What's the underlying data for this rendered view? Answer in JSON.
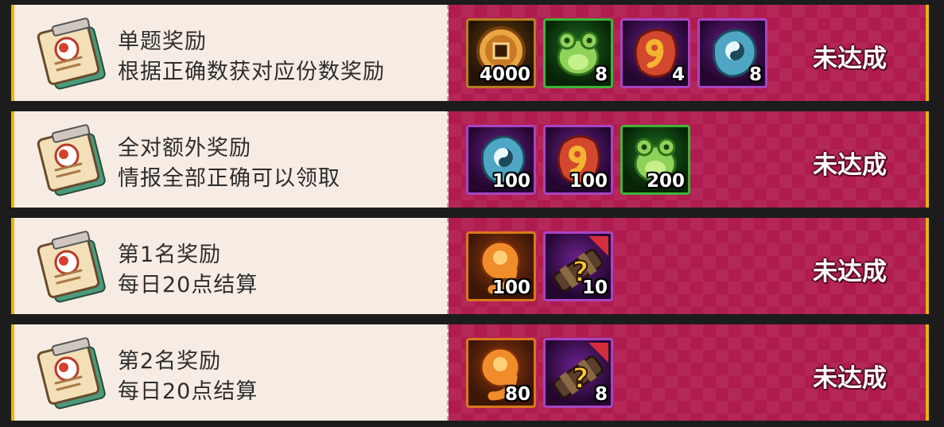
{
  "rows": [
    {
      "title": "单题奖励",
      "description": "根据正确数获对应份数奖励",
      "status": "未达成",
      "icon": "reward-book-icon",
      "rewards": [
        {
          "icon": "copper-coin-icon",
          "frame": "brown",
          "qty": "4000"
        },
        {
          "icon": "green-toad-icon",
          "frame": "green",
          "qty": "8"
        },
        {
          "icon": "red-magatama-stone-icon",
          "frame": "purple",
          "qty": "4"
        },
        {
          "icon": "blue-yinyang-stone-icon",
          "frame": "purple",
          "qty": "8"
        }
      ]
    },
    {
      "title": "全对额外奖励",
      "description": "情报全部正确可以领取",
      "status": "未达成",
      "icon": "reward-book-icon",
      "rewards": [
        {
          "icon": "blue-yinyang-stone-icon",
          "frame": "purple",
          "qty": "100"
        },
        {
          "icon": "red-magatama-stone-icon",
          "frame": "purple",
          "qty": "100"
        },
        {
          "icon": "green-toad-icon",
          "frame": "green",
          "qty": "200"
        }
      ]
    },
    {
      "title": "第1名奖励",
      "description": "每日20点结算",
      "status": "未达成",
      "icon": "reward-book-icon",
      "rewards": [
        {
          "icon": "orange-magatama-icon",
          "frame": "orange",
          "qty": "100"
        },
        {
          "icon": "mystery-scroll-icon",
          "frame": "purple",
          "qty": "10"
        }
      ]
    },
    {
      "title": "第2名奖励",
      "description": "每日20点结算",
      "status": "未达成",
      "icon": "reward-book-icon",
      "rewards": [
        {
          "icon": "orange-magatama-icon",
          "frame": "orange",
          "qty": "80"
        },
        {
          "icon": "mystery-scroll-icon",
          "frame": "purple",
          "qty": "8"
        }
      ]
    }
  ],
  "colors": {
    "panel_left": "#f6ece4",
    "panel_right": "#b01c50",
    "border_gold": "#e8b800",
    "text_dark": "#2d2d2d",
    "status_text": "#ffffff"
  }
}
